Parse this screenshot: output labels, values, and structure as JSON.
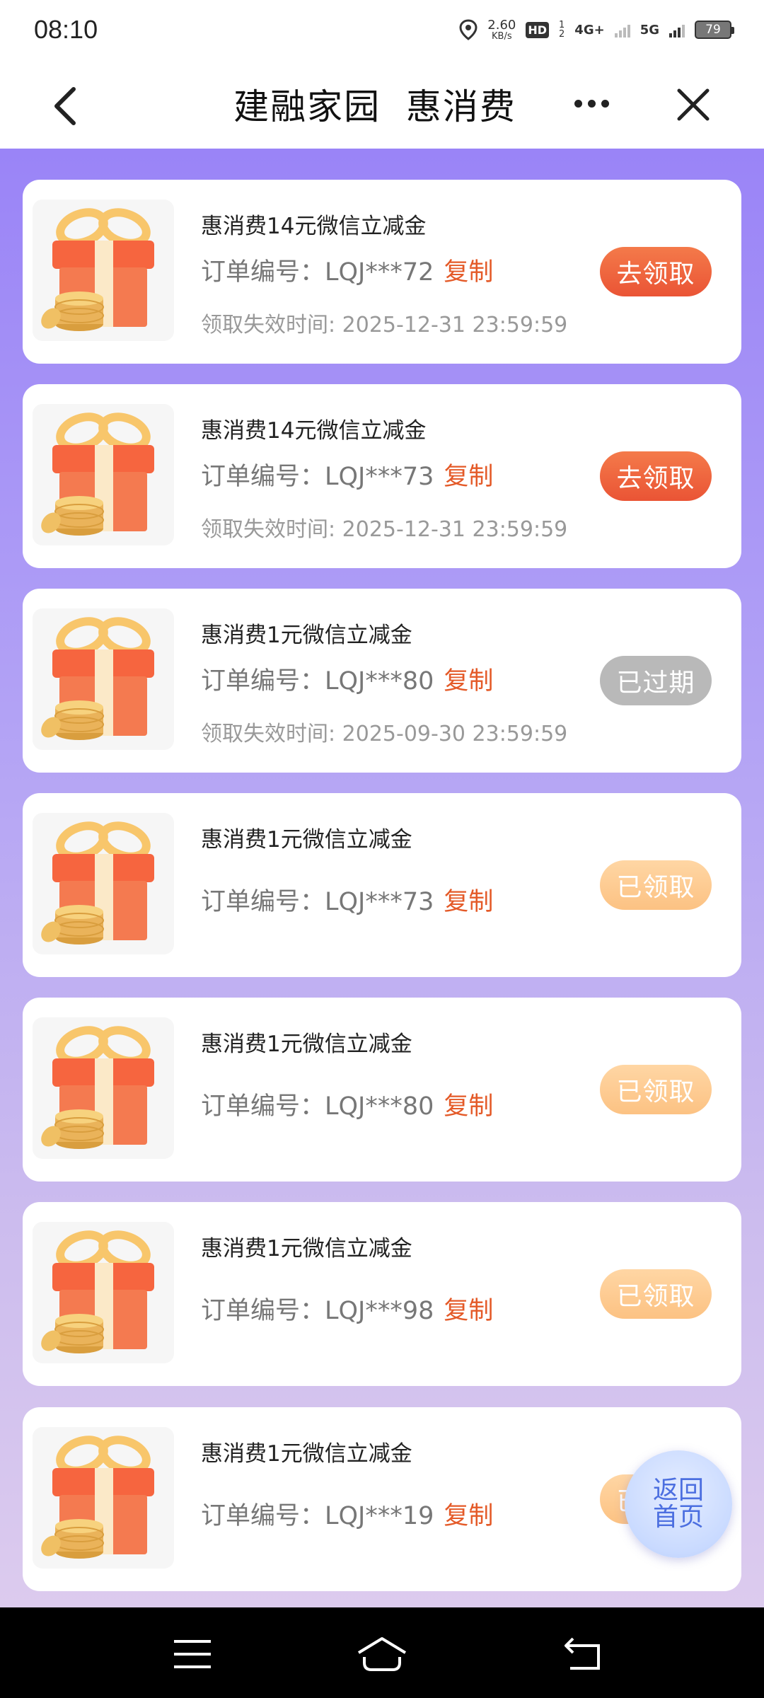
{
  "status": {
    "time": "08:10",
    "net_speed_value": "2.60",
    "net_speed_unit": "KB/s",
    "hd": "HD",
    "sim1": "1",
    "sim2": "2",
    "net1": "4G+",
    "net2": "5G",
    "battery": "79"
  },
  "header": {
    "title": "建融家园  惠消费"
  },
  "cards": [
    {
      "title": "惠消费14元微信立减金",
      "order_label": "订单编号：LQJ***72",
      "copy": "复制",
      "expire": "领取失效时间: 2025-12-31 23:59:59",
      "action": "去领取"
    },
    {
      "title": "惠消费14元微信立减金",
      "order_label": "订单编号：LQJ***73",
      "copy": "复制",
      "expire": "领取失效时间: 2025-12-31 23:59:59",
      "action": "去领取"
    },
    {
      "title": "惠消费1元微信立减金",
      "order_label": "订单编号：LQJ***80",
      "copy": "复制",
      "expire": "领取失效时间: 2025-09-30 23:59:59",
      "action": "已过期"
    },
    {
      "title": "惠消费1元微信立减金",
      "order_label": "订单编号：LQJ***73",
      "copy": "复制",
      "action": "已领取"
    },
    {
      "title": "惠消费1元微信立减金",
      "order_label": "订单编号：LQJ***80",
      "copy": "复制",
      "action": "已领取"
    },
    {
      "title": "惠消费1元微信立减金",
      "order_label": "订单编号：LQJ***98",
      "copy": "复制",
      "action": "已领取"
    },
    {
      "title": "惠消费1元微信立减金",
      "order_label": "订单编号：LQJ***19",
      "copy": "复制",
      "action": "已领取"
    }
  ],
  "fab": {
    "line1": "返回",
    "line2": "首页"
  },
  "colors": {
    "accent": "#e45a28",
    "claim_button": "#ef6440",
    "claimed_button": "#fdc98e",
    "expired_button": "#b9b9b9",
    "background_top": "#9a84f7"
  },
  "icons": {
    "back": "chevron-left-icon",
    "more": "more-dots-icon",
    "close": "close-icon",
    "gift": "gift-coins-icon",
    "menu": "menu-icon",
    "home": "home-icon",
    "return": "return-icon"
  }
}
